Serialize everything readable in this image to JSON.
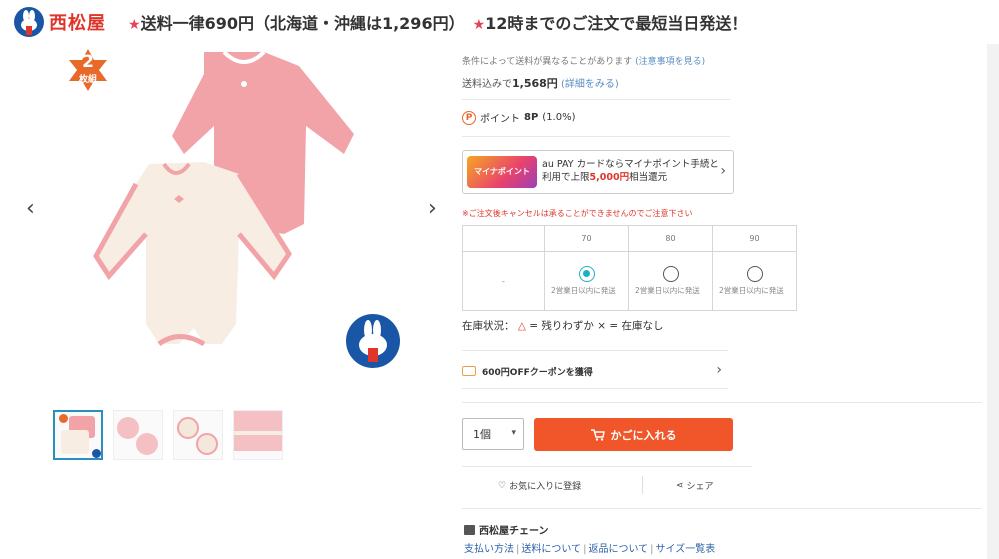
{
  "header": {
    "logo_text": "西松屋",
    "banner_star1": "★",
    "banner_text1": "送料一律690円（北海道・沖縄は1,296円）",
    "banner_star2": "★",
    "banner_text2": "12時までのご注文で最短当日発送！"
  },
  "gallery": {
    "badge_num": "2",
    "badge_label": "枚組",
    "prev_icon": "‹",
    "next_icon": "›",
    "thumbnail_count": 4
  },
  "shipping": {
    "notice": "条件によって送料が異なることがあります",
    "notice_link": "(注意事項を見る)",
    "price_prefix": "送料込みで",
    "price_value": "1,568円",
    "price_link": "(詳細をみる)"
  },
  "points": {
    "icon": "P",
    "label": "ポイント",
    "value": "8P",
    "rate": "(1.0%)"
  },
  "aupay": {
    "logo_text": "マイナポイント",
    "line1": "au PAY カードならマイナポイント手続と",
    "line2_prefix": "利用で上限",
    "line2_highlight": "5,000円",
    "line2_suffix": "相当還元",
    "chevron": "›"
  },
  "warning": "※ご注文後キャンセルは承ることができませんのでご注意下さい",
  "size_table": {
    "headers": [
      "",
      "70",
      "80",
      "90"
    ],
    "color_cell": "-",
    "options": [
      {
        "size": "70",
        "selected": true,
        "note": "2営業日以内に発送"
      },
      {
        "size": "80",
        "selected": false,
        "note": "2営業日以内に発送"
      },
      {
        "size": "90",
        "selected": false,
        "note": "2営業日以内に発送"
      }
    ]
  },
  "stock": {
    "label": "在庫状況：",
    "tri": "△",
    "tri_text": "= 残りわずか",
    "x": "×",
    "x_text": "= 在庫なし"
  },
  "coupon": {
    "text": "600円OFFクーポンを獲得",
    "chevron": "›"
  },
  "purchase": {
    "qty_value": "1個",
    "qty_caret": "▾",
    "cart_label": "かごに入れる"
  },
  "actions": {
    "fav_icon": "♡",
    "fav_label": "お気に入りに登録",
    "share_icon": "⋖",
    "share_label": "シェア"
  },
  "store": {
    "name": "西松屋チェーン",
    "links": [
      "支払い方法",
      "送料について",
      "返品について",
      "サイズ一覧表"
    ],
    "pipe": "|"
  },
  "colors": {
    "accent": "#f0562a",
    "brand_blue": "#1957a6",
    "radio_active": "#1ab0c9",
    "link": "#2d63a8"
  }
}
